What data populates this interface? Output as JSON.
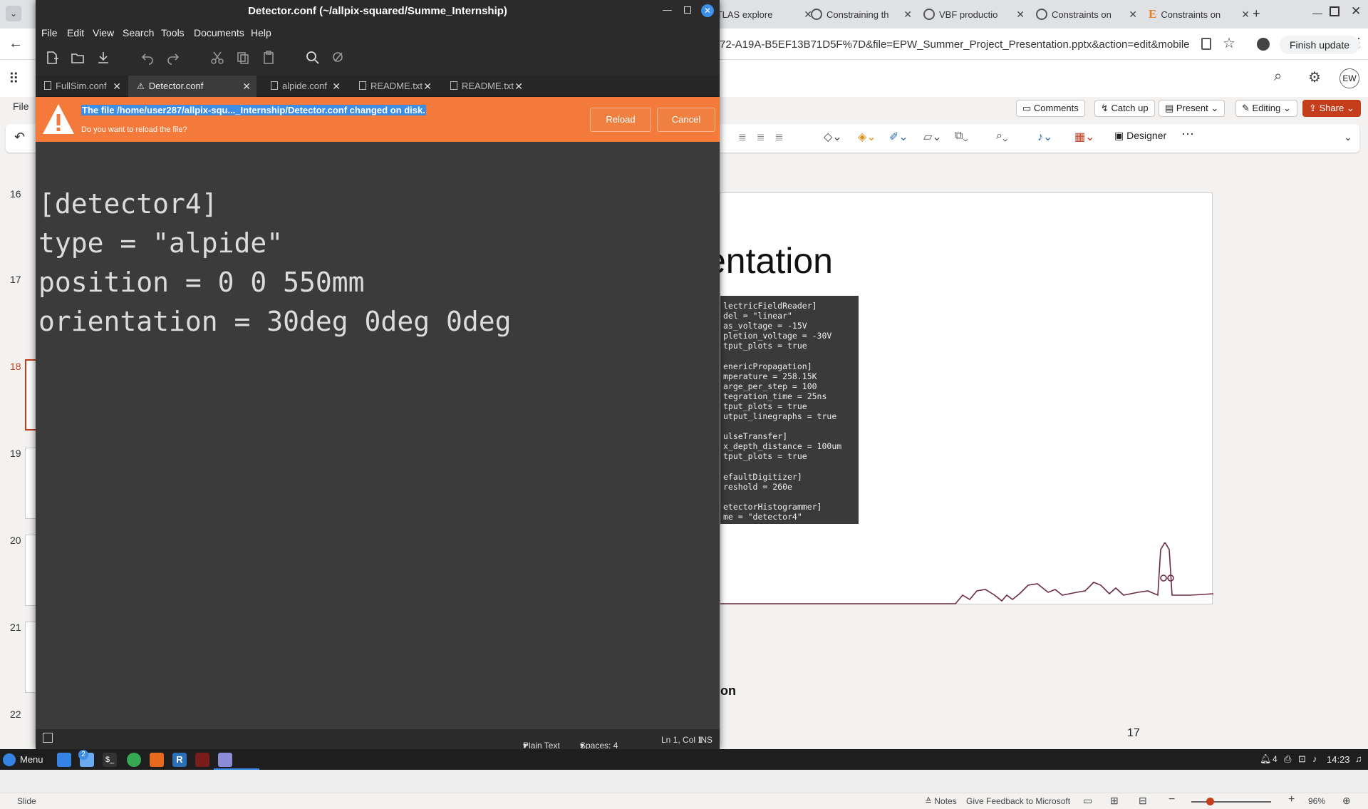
{
  "browser": {
    "tabs": [
      {
        "label": "ATLAS explore"
      },
      {
        "label": "Constraining th"
      },
      {
        "label": "VBF productio"
      },
      {
        "label": "Constraints on"
      },
      {
        "label": "Constraints on"
      }
    ],
    "url": "72-A19A-B5EF13B71D5F%7D&file=EPW_Summer_Project_Presentation.pptx&action=edit&mobileredirect=true",
    "finish_update": "Finish update"
  },
  "office": {
    "file_menu": "File",
    "comments": "Comments",
    "catch_up": "Catch up",
    "present": "Present",
    "editing": "Editing",
    "share": "Share",
    "designer": "Designer",
    "avatar": "EW",
    "thumbnail_numbers": [
      "16",
      "17",
      "18",
      "19",
      "20",
      "21",
      "22"
    ],
    "slide": {
      "title_fragment": "entation",
      "code_lines": "lectricFieldReader]\ndel = \"linear\"\nas_voltage = -15V\npletion_voltage = -30V\ntput_plots = true\n\nenericPropagation]\nmperature = 258.15K\narge_per_step = 100\ntegration_time = 25ns\ntput_plots = true\nutput_linegraphs = true\n\nulseTransfer]\nx_depth_distance = 100um\ntput_plots = true\n\nefaultDigitizer]\nreshold = 260e\n\netectorHistogrammer]\nme = \"detector4\"",
      "bold_fragment": "on",
      "page_number": "17"
    },
    "status": {
      "slide_label": "Slide",
      "notes": "Notes",
      "feedback": "Give Feedback to Microsoft",
      "zoom": "96%"
    }
  },
  "editor": {
    "title": "Detector.conf (~/allpix-squared/Summe_Internship)",
    "menu": [
      "File",
      "Edit",
      "View",
      "Search",
      "Tools",
      "Documents",
      "Help"
    ],
    "tabs": [
      {
        "label": "FullSim.conf",
        "active": false
      },
      {
        "label": "Detector.conf",
        "active": true
      },
      {
        "label": "alpide.conf",
        "active": false
      },
      {
        "label": "README.txt",
        "active": false
      },
      {
        "label": "README.txt",
        "active": false
      }
    ],
    "infobar": {
      "message": "The file /home/user287/allpix-squ..._Internship/Detector.conf changed on disk.",
      "question": "Do you want to reload the file?",
      "reload": "Reload",
      "cancel": "Cancel"
    },
    "content": "[detector4]\ntype = \"alpide\"\nposition = 0 0 550mm\norientation = 30deg 0deg 0deg",
    "status": {
      "language": "Plain Text",
      "spaces": "Spaces: 4",
      "position": "Ln 1, Col 1",
      "mode": "INS"
    }
  },
  "taskbar": {
    "menu": "Menu",
    "badge": "2",
    "tray_count": "4",
    "clock": "14:23"
  }
}
